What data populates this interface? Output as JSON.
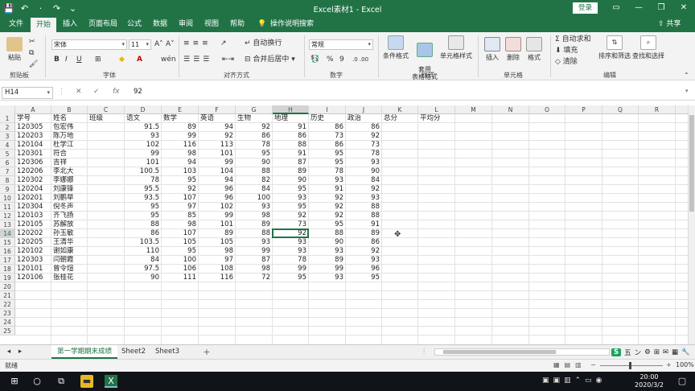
{
  "titlebar": {
    "title": "Excel素材1 - Excel",
    "login": "登录",
    "qat": [
      "💾",
      "↶",
      "·",
      "↷",
      "⌄"
    ]
  },
  "tabs": [
    "文件",
    "开始",
    "插入",
    "页面布局",
    "公式",
    "数据",
    "审阅",
    "视图",
    "帮助"
  ],
  "tell_me": "操作说明搜索",
  "share": "共享",
  "ribbon": {
    "groups": {
      "clipboard": "剪贴板",
      "font": "字体",
      "alignment": "对齐方式",
      "number": "数字",
      "styles": "样式",
      "cells": "单元格",
      "editing": "编辑"
    },
    "paste": "粘贴",
    "font_name": "宋体",
    "font_size": "11",
    "font_grow": "A˄",
    "font_shrink": "A˅",
    "bold": "B",
    "italic": "I",
    "underline": "U",
    "wrap_text": "自动换行",
    "merge_center": "合并后居中",
    "number_format": "常规",
    "percent": "%",
    "comma": "9",
    "cond_format": "条件格式",
    "table_format": "套用\n表格格式",
    "cell_styles": "单元格样式",
    "insert": "插入",
    "delete": "删除",
    "format": "格式",
    "autosum": "自动求和",
    "fill": "填充",
    "clear": "清除",
    "sort_filter": "排序和筛选",
    "find_select": "查找和选择"
  },
  "formula_bar": {
    "name_box": "H14",
    "fx": "fx",
    "cancel": "✕",
    "confirm": "✓",
    "value": "92"
  },
  "columns": [
    "A",
    "B",
    "C",
    "D",
    "E",
    "F",
    "G",
    "H",
    "I",
    "J",
    "K",
    "L",
    "M",
    "N",
    "O",
    "P",
    "Q",
    "R"
  ],
  "row_numbers": [
    "1",
    "2",
    "3",
    "4",
    "5",
    "6",
    "7",
    "8",
    "9",
    "10",
    "11",
    "12",
    "13",
    "14",
    "15",
    "16",
    "17",
    "18",
    "19",
    "20",
    "21",
    "22",
    "23",
    "24",
    "25"
  ],
  "selected_cell": "H14",
  "header_row": [
    "学号",
    "姓名",
    "班级",
    "语文",
    "数学",
    "英语",
    "生物",
    "地理",
    "历史",
    "政治",
    "总分",
    "平均分"
  ],
  "rows": [
    [
      "120305",
      "包宏伟",
      "",
      "91.5",
      "89",
      "94",
      "92",
      "91",
      "86",
      "86"
    ],
    [
      "120203",
      "陈万地",
      "",
      "93",
      "99",
      "92",
      "86",
      "86",
      "73",
      "92"
    ],
    [
      "120104",
      "杜学江",
      "",
      "102",
      "116",
      "113",
      "78",
      "88",
      "86",
      "73"
    ],
    [
      "120301",
      "符合",
      "",
      "99",
      "98",
      "101",
      "95",
      "91",
      "95",
      "78"
    ],
    [
      "120306",
      "吉祥",
      "",
      "101",
      "94",
      "99",
      "90",
      "87",
      "95",
      "93"
    ],
    [
      "120206",
      "李北大",
      "",
      "100.5",
      "103",
      "104",
      "88",
      "89",
      "78",
      "90"
    ],
    [
      "120302",
      "李娜娜",
      "",
      "78",
      "95",
      "94",
      "82",
      "90",
      "93",
      "84"
    ],
    [
      "120204",
      "刘康锋",
      "",
      "95.5",
      "92",
      "96",
      "84",
      "95",
      "91",
      "92"
    ],
    [
      "120201",
      "刘鹏举",
      "",
      "93.5",
      "107",
      "96",
      "100",
      "93",
      "92",
      "93"
    ],
    [
      "120304",
      "倪冬声",
      "",
      "95",
      "97",
      "102",
      "93",
      "95",
      "92",
      "88"
    ],
    [
      "120103",
      "齐飞扬",
      "",
      "95",
      "85",
      "99",
      "98",
      "92",
      "92",
      "88"
    ],
    [
      "120105",
      "苏解放",
      "",
      "88",
      "98",
      "101",
      "89",
      "73",
      "95",
      "91"
    ],
    [
      "120202",
      "孙玉敏",
      "",
      "86",
      "107",
      "89",
      "88",
      "92",
      "88",
      "89"
    ],
    [
      "120205",
      "王清华",
      "",
      "103.5",
      "105",
      "105",
      "93",
      "93",
      "90",
      "86"
    ],
    [
      "120102",
      "谢如康",
      "",
      "110",
      "95",
      "98",
      "99",
      "93",
      "93",
      "92"
    ],
    [
      "120303",
      "闫朝霞",
      "",
      "84",
      "100",
      "97",
      "87",
      "78",
      "89",
      "93"
    ],
    [
      "120101",
      "曾令煊",
      "",
      "97.5",
      "106",
      "108",
      "98",
      "99",
      "99",
      "96"
    ],
    [
      "120106",
      "张桂花",
      "",
      "90",
      "111",
      "116",
      "72",
      "95",
      "93",
      "95"
    ]
  ],
  "sheets": [
    "第一学期期末成绩",
    "Sheet2",
    "Sheet3"
  ],
  "add_sheet": "+",
  "status": {
    "ready": "就绪",
    "zoom": "100%"
  },
  "ime_bar": [
    "S",
    "五",
    "ン",
    "⚙",
    "⊞",
    "✉",
    "▦",
    "🔧"
  ],
  "clock": {
    "time": "20:00",
    "date": "2020/3/2"
  }
}
